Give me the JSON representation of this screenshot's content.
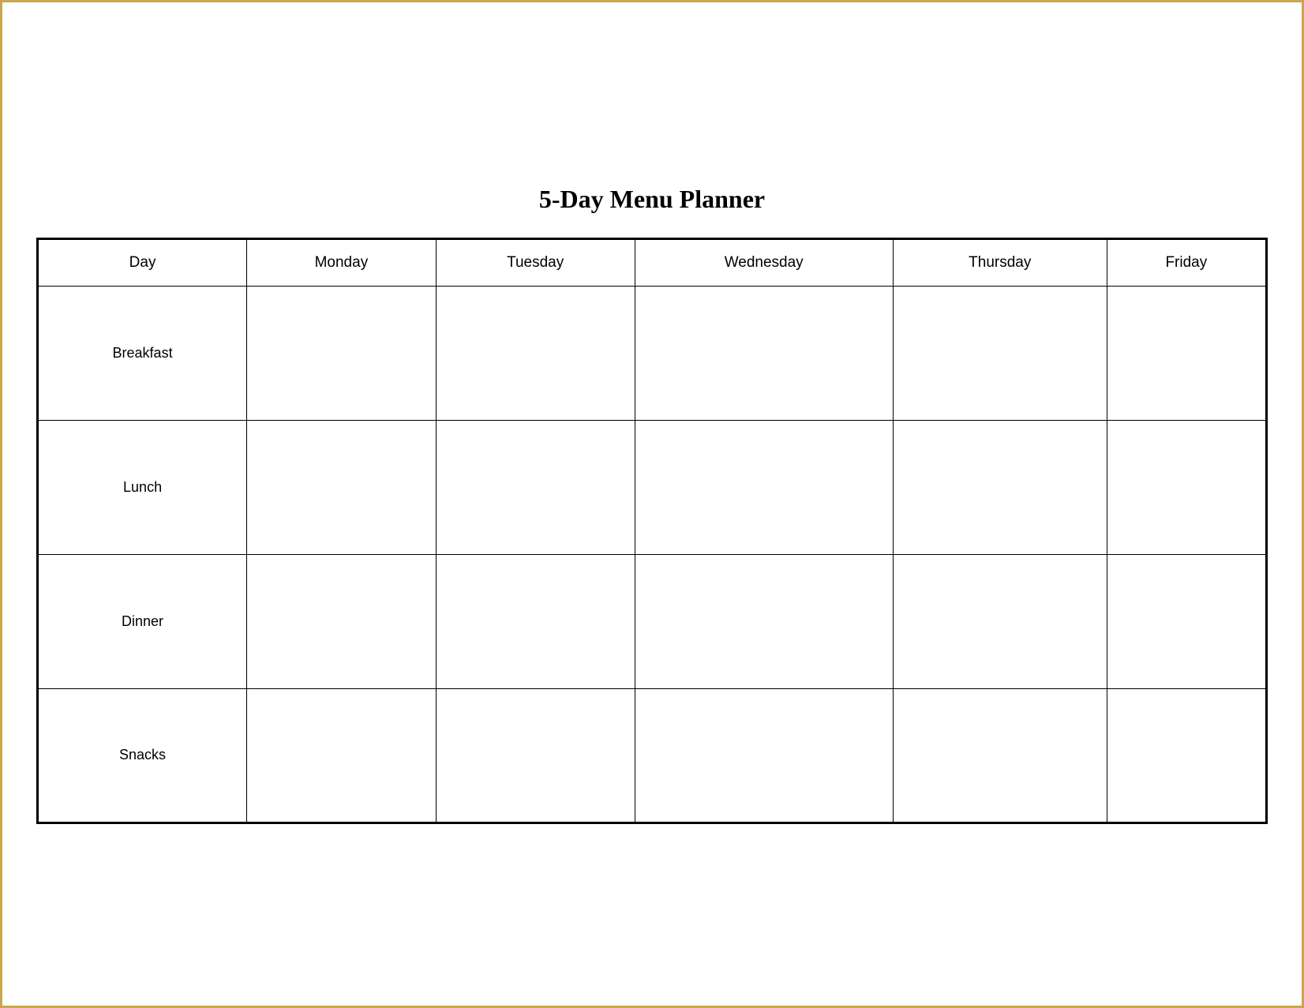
{
  "title": "5-Day Menu Planner",
  "table": {
    "headers": [
      "Day",
      "Monday",
      "Tuesday",
      "Wednesday",
      "Thursday",
      "Friday"
    ],
    "rows": [
      {
        "label": "Breakfast",
        "cells": [
          "",
          "",
          "",
          "",
          ""
        ]
      },
      {
        "label": "Lunch",
        "cells": [
          "",
          "",
          "",
          "",
          ""
        ]
      },
      {
        "label": "Dinner",
        "cells": [
          "",
          "",
          "",
          "",
          ""
        ]
      },
      {
        "label": "Snacks",
        "cells": [
          "",
          "",
          "",
          "",
          ""
        ]
      }
    ]
  }
}
